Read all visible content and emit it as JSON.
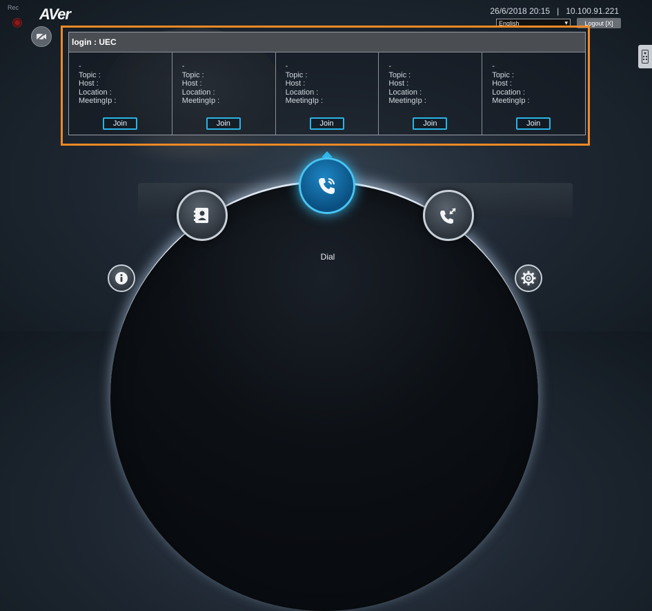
{
  "header": {
    "record_label": "Rec",
    "logo": "AVer",
    "datetime": "26/6/2018 20:15",
    "separator": "|",
    "ip": "10.100.91.221",
    "language": "English",
    "language_arrow": "▾",
    "logout_label": "Logout [X]"
  },
  "panel": {
    "title": "login : UEC",
    "slots": [
      {
        "dash": "-",
        "topic": "Topic :",
        "host": "Host :",
        "location": "Location :",
        "meeting_ip": "MeetingIp :",
        "join": "Join"
      },
      {
        "dash": "-",
        "topic": "Topic :",
        "host": "Host :",
        "location": "Location :",
        "meeting_ip": "MeetingIp :",
        "join": "Join"
      },
      {
        "dash": "-",
        "topic": "Topic :",
        "host": "Host :",
        "location": "Location :",
        "meeting_ip": "MeetingIp :",
        "join": "Join"
      },
      {
        "dash": "-",
        "topic": "Topic :",
        "host": "Host :",
        "location": "Location :",
        "meeting_ip": "MeetingIp :",
        "join": "Join"
      },
      {
        "dash": "-",
        "topic": "Topic :",
        "host": "Host :",
        "location": "Location :",
        "meeting_ip": "MeetingIp :",
        "join": "Join"
      }
    ]
  },
  "menu": {
    "dial_label": "Dial",
    "icons": {
      "contacts": "contacts-icon",
      "dial": "phone-wave-icon",
      "call_transfer": "call-transfer-icon",
      "info": "info-icon",
      "settings": "gear-icon"
    }
  },
  "colors": {
    "highlight": "#f08a24",
    "accent": "#29b5ea"
  }
}
